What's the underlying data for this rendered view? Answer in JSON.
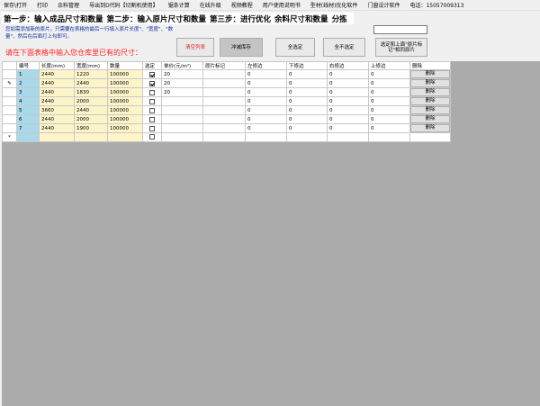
{
  "menu": [
    "保存\\打开",
    "打印",
    "余料管理",
    "导出到D代码【切割机使用】",
    "锯条计算",
    "在线升级",
    "视频教程",
    "用户使用说明书",
    "型材(线材)优化软件",
    "门窗设计软件",
    "电话：15057009313"
  ],
  "steps": [
    "第一步：输入成品尺寸和数量",
    "第二步：输入原片尺寸和数量",
    "第三步：进行优化",
    "余料尺寸和数量",
    "分拣"
  ],
  "hint": "您如需添加新的原片，只需要在表格的最后一行填入原片长度\"、\"宽度\"、\"数量\"，然后在后面打上勾即可。",
  "warning": "请在下面表格中输入您仓库里已有的尺寸：",
  "top_input_value": "",
  "buttons": {
    "clear_list": "清空列表",
    "clear_stock": "冲减库存",
    "select_all": "全选定",
    "deselect_all": "全不选定",
    "select_marked": "选定和上面\"原片标记\"相同原片"
  },
  "table": {
    "headers": [
      "编号",
      "长度(mm)",
      "宽度(mm)",
      "数量",
      "选定",
      "单价(元/m²)",
      "原片标记",
      "左修边",
      "下修边",
      "右修边",
      "上修边",
      "删除"
    ],
    "delete_label": "删除",
    "rows": [
      {
        "marker": "",
        "id": "1",
        "length": "2440",
        "width": "1220",
        "qty": "100000",
        "checked": true,
        "price": "20",
        "mark": "",
        "left": "0",
        "bottom": "0",
        "right": "0",
        "top": "0"
      },
      {
        "marker": "✎",
        "id": "2",
        "length": "2440",
        "width": "2440",
        "qty": "100000",
        "checked": true,
        "price": "20",
        "mark": "",
        "left": "0",
        "bottom": "0",
        "right": "0",
        "top": "0"
      },
      {
        "marker": "",
        "id": "3",
        "length": "2440",
        "width": "1830",
        "qty": "100000",
        "checked": false,
        "price": "20",
        "mark": "",
        "left": "0",
        "bottom": "0",
        "right": "0",
        "top": "0"
      },
      {
        "marker": "",
        "id": "4",
        "length": "2440",
        "width": "2000",
        "qty": "100000",
        "checked": false,
        "price": "",
        "mark": "",
        "left": "0",
        "bottom": "0",
        "right": "0",
        "top": "0"
      },
      {
        "marker": "",
        "id": "5",
        "length": "3660",
        "width": "2440",
        "qty": "100000",
        "checked": false,
        "price": "",
        "mark": "",
        "left": "0",
        "bottom": "0",
        "right": "0",
        "top": "0"
      },
      {
        "marker": "",
        "id": "6",
        "length": "2440",
        "width": "2000",
        "qty": "100000",
        "checked": false,
        "price": "",
        "mark": "",
        "left": "0",
        "bottom": "0",
        "right": "0",
        "top": "0"
      },
      {
        "marker": "",
        "id": "7",
        "length": "2440",
        "width": "1900",
        "qty": "100000",
        "checked": false,
        "price": "",
        "mark": "",
        "left": "0",
        "bottom": "0",
        "right": "0",
        "top": "0"
      }
    ],
    "new_row_marker": "*"
  }
}
